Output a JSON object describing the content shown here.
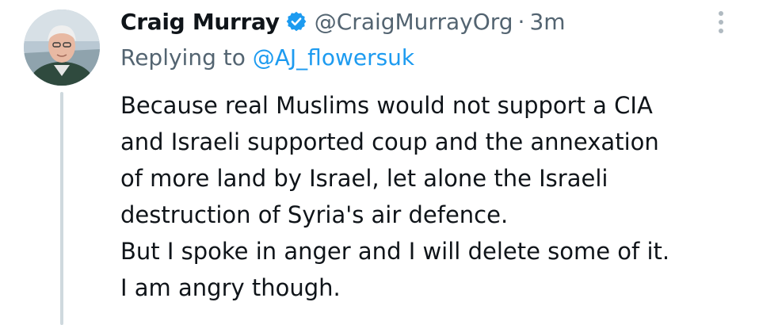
{
  "author": {
    "display_name": "Craig Murray",
    "handle": "@CraigMurrayOrg",
    "separator": "·",
    "time": "3m",
    "verified": true
  },
  "reply": {
    "prefix": "Replying to ",
    "mention": "@AJ_flowersuk"
  },
  "body_lines": [
    "Because real Muslims would not support a CIA",
    "and Israeli supported coup and the annexation",
    "of more land by Israel, let alone the Israeli",
    "destruction of Syria's air defence.",
    "But I spoke in anger and I will delete some of it.",
    "I am angry though."
  ],
  "icons": {
    "verified": "verified-badge-icon",
    "more": "more-options-icon"
  },
  "colors": {
    "text": "#0f1419",
    "secondary": "#536471",
    "accent": "#1d9bf0",
    "thread_line": "#cfd9de"
  }
}
